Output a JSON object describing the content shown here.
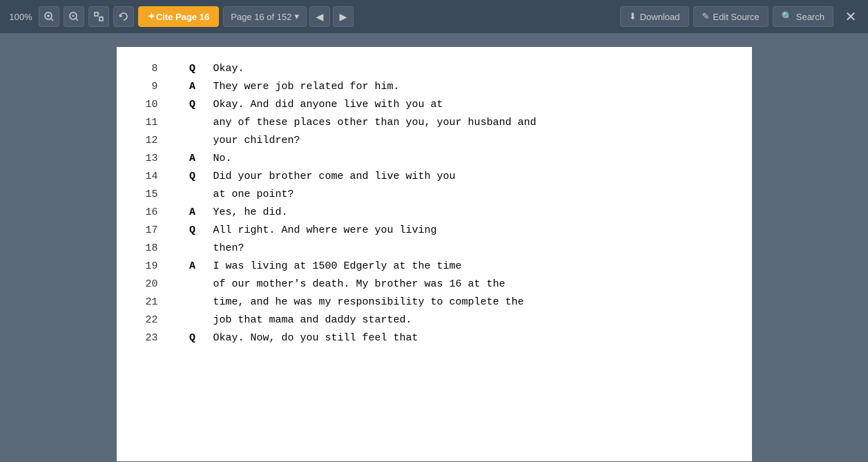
{
  "toolbar": {
    "zoom_level": "100%",
    "cite_label": "✦ Cite Page 16",
    "page_nav_label": "Page 16 of 152",
    "page_nav_dropdown": "▾",
    "download_label": "⬇ Download",
    "edit_source_label": "✎ Edit Source",
    "search_label": "🔍 Search",
    "close_label": "✕"
  },
  "document": {
    "lines": [
      {
        "num": "8",
        "speaker": "Q",
        "text": "Okay."
      },
      {
        "num": "9",
        "speaker": "A",
        "text": "They were job related for him."
      },
      {
        "num": "10",
        "speaker": "Q",
        "text": "Okay.  And did anyone live with you at"
      },
      {
        "num": "11",
        "speaker": "",
        "text": "any of these places other than you, your husband and"
      },
      {
        "num": "12",
        "speaker": "",
        "text": "your children?"
      },
      {
        "num": "13",
        "speaker": "A",
        "text": "No."
      },
      {
        "num": "14",
        "speaker": "Q",
        "text": "Did your brother come and live with you"
      },
      {
        "num": "15",
        "speaker": "",
        "text": "at one point?"
      },
      {
        "num": "16",
        "speaker": "A",
        "text": "Yes, he did."
      },
      {
        "num": "17",
        "speaker": "Q",
        "text": "All right.  And where were you living"
      },
      {
        "num": "18",
        "speaker": "",
        "text": "then?"
      },
      {
        "num": "19",
        "speaker": "A",
        "text": "I was living at 1500 Edgerly at the time"
      },
      {
        "num": "20",
        "speaker": "",
        "text": "of our mother's death.  My brother was 16 at the"
      },
      {
        "num": "21",
        "speaker": "",
        "text": "time, and he was my responsibility to complete the"
      },
      {
        "num": "22",
        "speaker": "",
        "text": "job that mama and daddy started."
      },
      {
        "num": "23",
        "speaker": "Q",
        "text": "Okay.  Now, do you still feel that"
      }
    ]
  }
}
